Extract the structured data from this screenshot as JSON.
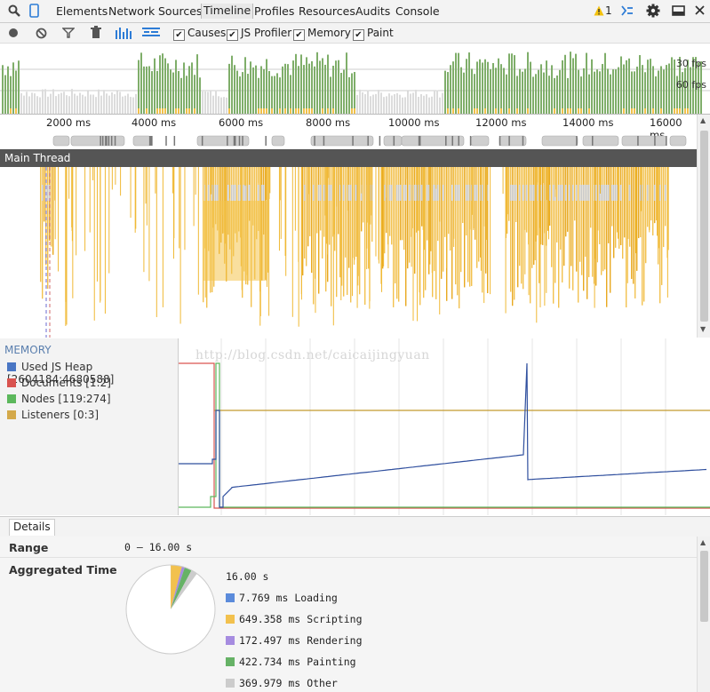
{
  "tabs": [
    {
      "label": "Elements"
    },
    {
      "label": "Network"
    },
    {
      "label": "Sources"
    },
    {
      "label": "Timeline"
    },
    {
      "label": "Profiles"
    },
    {
      "label": "Resources"
    },
    {
      "label": "Audits"
    },
    {
      "label": "Console"
    }
  ],
  "active_tab": "Timeline",
  "warning_count": "1",
  "toolbar": {
    "checkboxes": [
      {
        "label": "Causes",
        "checked": true
      },
      {
        "label": "JS Profiler",
        "checked": true
      },
      {
        "label": "Memory",
        "checked": true
      },
      {
        "label": "Paint",
        "checked": true
      }
    ]
  },
  "overview": {
    "fps_30": "30 fps",
    "fps_60": "60 fps"
  },
  "ruler": {
    "ticks": [
      "2000 ms",
      "4000 ms",
      "6000 ms",
      "8000 ms",
      "10000 ms",
      "12000 ms",
      "14000 ms",
      "16000 ms"
    ]
  },
  "main_thread": {
    "label": "Main Thread"
  },
  "memory": {
    "title": "MEMORY",
    "legend": [
      {
        "label": "Used JS Heap [2604184:4680588]",
        "color": "#4a76c4"
      },
      {
        "label": "Documents [1:2]",
        "color": "#d9534f"
      },
      {
        "label": "Nodes [119:274]",
        "color": "#5cb85c"
      },
      {
        "label": "Listeners [0:3]",
        "color": "#d4a94a"
      }
    ],
    "watermark": "http://blog.csdn.net/caicaijingyuan"
  },
  "details": {
    "tab_label": "Details",
    "range_label": "Range",
    "range_value": "0 – 16.00 s",
    "aggregated_label": "Aggregated Time",
    "total": "16.00 s",
    "rows": [
      {
        "value": "7.769 ms",
        "name": "Loading",
        "color": "#5b8bdb"
      },
      {
        "value": "649.358 ms",
        "name": "Scripting",
        "color": "#f2c14e"
      },
      {
        "value": "172.497 ms",
        "name": "Rendering",
        "color": "#a68ce0"
      },
      {
        "value": "422.734 ms",
        "name": "Painting",
        "color": "#66b266"
      },
      {
        "value": "369.979 ms",
        "name": "Other",
        "color": "#cccccc"
      }
    ],
    "pie": [
      7.769,
      649.358,
      172.497,
      422.734,
      369.979,
      14377.663
    ]
  }
}
